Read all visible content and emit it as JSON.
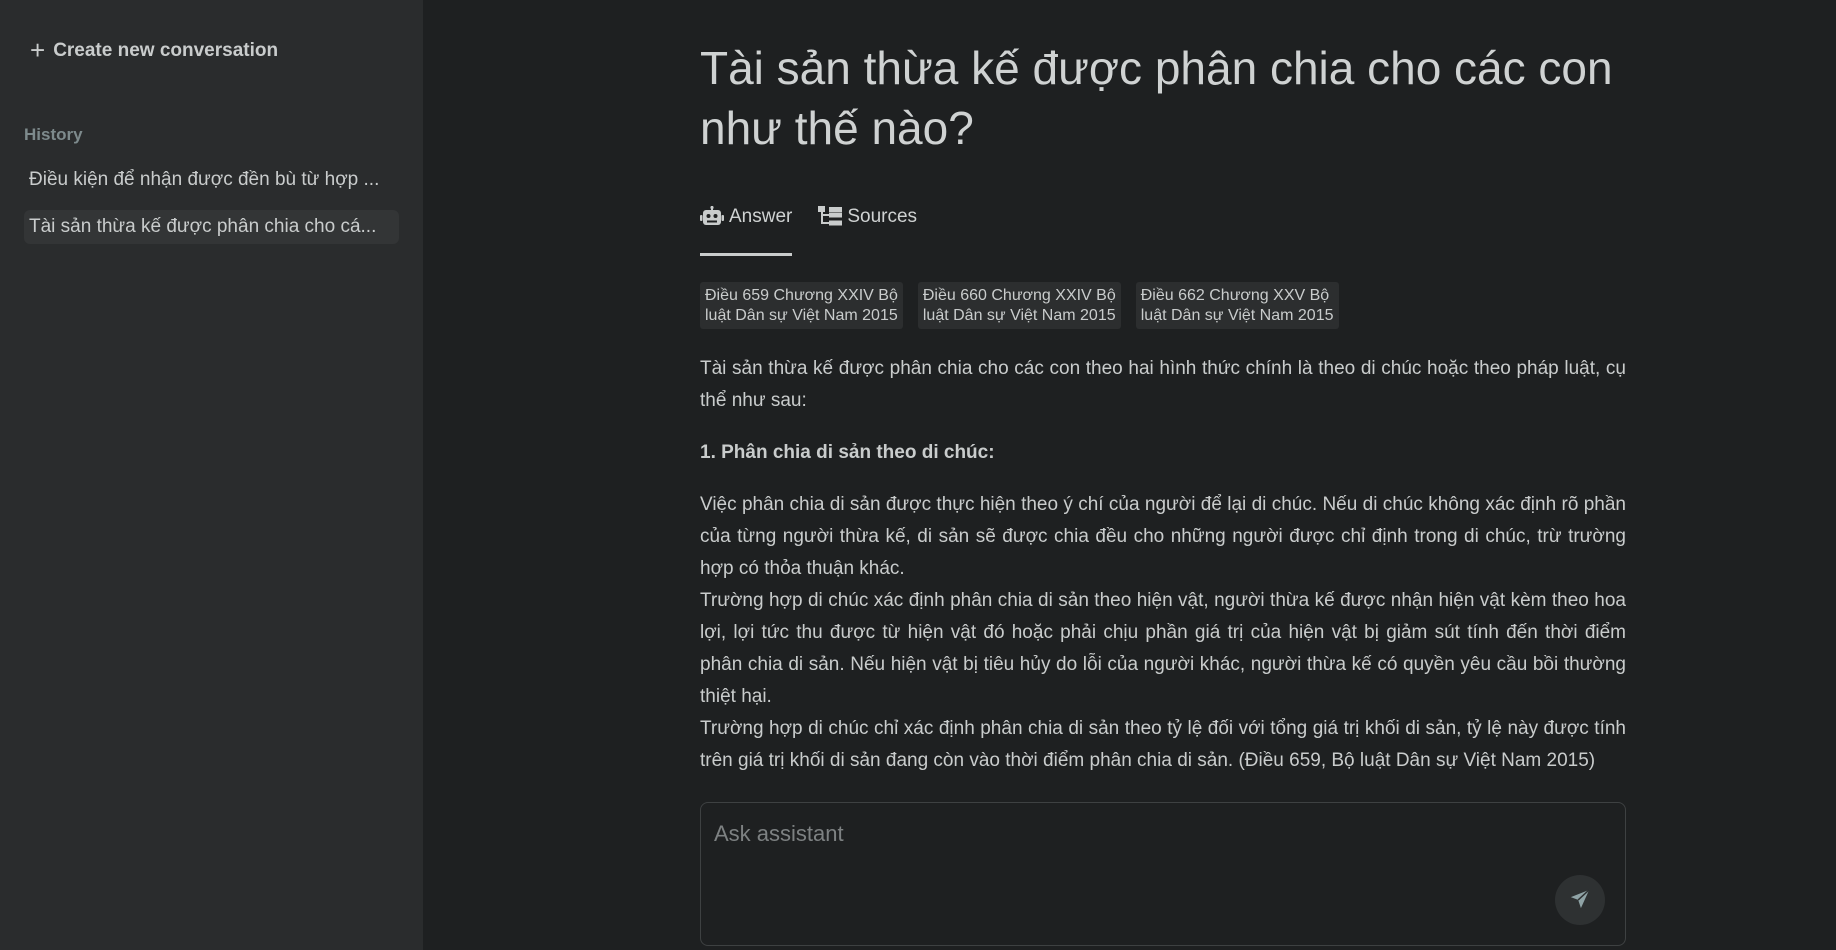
{
  "sidebar": {
    "new_conversation_label": "Create new conversation",
    "history_label": "History",
    "items": [
      {
        "label": "Điều kiện để nhận được đền bù từ hợp ..."
      },
      {
        "label": "Tài sản thừa kế được phân chia cho cá..."
      }
    ]
  },
  "main": {
    "title": "Tài sản thừa kế được phân chia cho các con như thế nào?",
    "tabs": [
      {
        "label": "Answer",
        "icon": "robot-icon"
      },
      {
        "label": "Sources",
        "icon": "sitemap-icon"
      }
    ],
    "sources": [
      {
        "label": "Điều 659 Chương XXIV Bộ\nluật Dân sự Việt Nam 2015"
      },
      {
        "label": "Điều 660 Chương XXIV Bộ\nluật Dân sự Việt Nam 2015"
      },
      {
        "label": "Điều 662 Chương XXV Bộ\nluật Dân sự Việt Nam 2015"
      }
    ],
    "answer": {
      "intro": "Tài sản thừa kế được phân chia cho các con theo hai hình thức chính là theo di chúc hoặc theo pháp luật, cụ thể như sau:",
      "heading": "1. Phân chia di sản theo di chúc:",
      "paragraphs": [
        "Việc phân chia di sản được thực hiện theo ý chí của người để lại di chúc. Nếu di chúc không xác định rõ phần của từng người thừa kế, di sản sẽ được chia đều cho những người được chỉ định trong di chúc, trừ trường hợp có thỏa thuận khác.",
        "Trường hợp di chúc xác định phân chia di sản theo hiện vật, người thừa kế được nhận hiện vật kèm theo hoa lợi, lợi tức thu được từ hiện vật đó hoặc phải chịu phần giá trị của hiện vật bị giảm sút tính đến thời điểm phân chia di sản. Nếu hiện vật bị tiêu hủy do lỗi của người khác, người thừa kế có quyền yêu cầu bồi thường thiệt hại.",
        "Trường hợp di chúc chỉ xác định phân chia di sản theo tỷ lệ đối với tổng giá trị khối di sản, tỷ lệ này được tính trên giá trị khối di sản đang còn vào thời điểm phân chia di sản. (Điều 659, Bộ luật Dân sự Việt Nam 2015)"
      ]
    },
    "input": {
      "placeholder": "Ask assistant",
      "value": ""
    }
  },
  "colors": {
    "background": "#1e2021",
    "sidebar": "#2a2c2d",
    "text": "#c9cccc",
    "muted": "#7d8a8c"
  }
}
